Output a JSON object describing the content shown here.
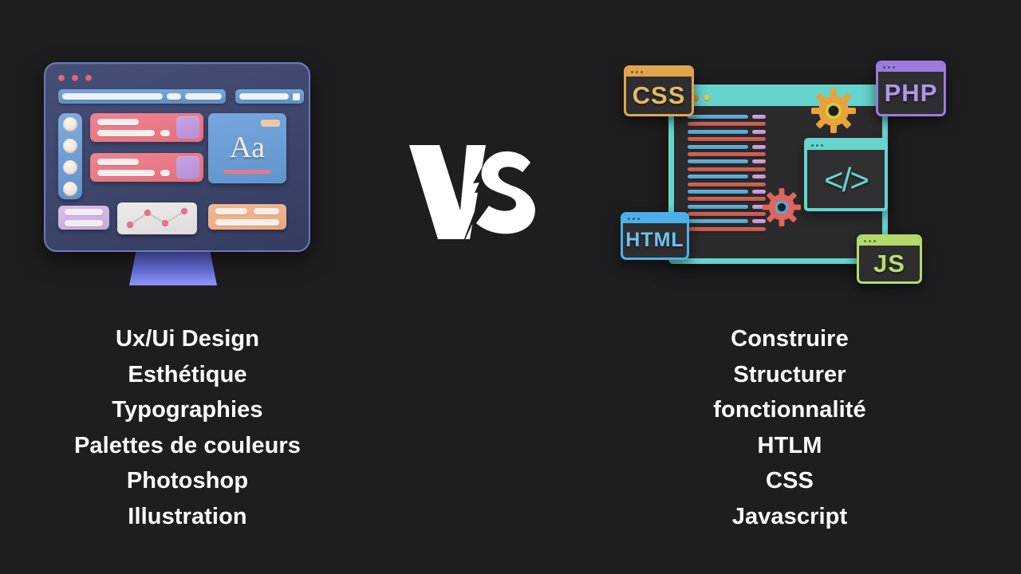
{
  "background_color": "#1e1e20",
  "center": {
    "logo_text": "VS",
    "logo_name": "versus-lightning-logo",
    "logo_color": "#ffffff"
  },
  "left": {
    "illustration_name": "ux-ui-design-monitor-illustration",
    "monitor": {
      "frame_color": "#3d456b",
      "border_color": "#6d79b8",
      "stand_color": "#6b74e2",
      "window_dots": [
        "#e06a7e",
        "#e06a7e",
        "#e06a7e"
      ],
      "typography_card": {
        "sample_text": "Aa",
        "background_color": "#6294cc",
        "underline_color": "#e4798f"
      },
      "rail_icon_count": 4,
      "pink_card_count": 2,
      "chart_point_count": 4
    },
    "items": [
      "Ux/Ui Design",
      "Esthétique",
      "Typographies",
      "Palettes de couleurs",
      "Photoshop",
      "Illustration"
    ]
  },
  "right": {
    "illustration_name": "web-development-code-illustration",
    "window": {
      "accent_color": "#66d4cd",
      "body_color": "#2b2b2d",
      "title_dots": [
        "#d4554c",
        "#e2943a",
        "#d8cc50"
      ],
      "code_line_colors": {
        "blue": "#4f9dc6",
        "red": "#bf5348",
        "tag": "#c28ccb"
      },
      "code_line_count": 16,
      "snippet_glyph": "</>",
      "snippet_color": "#66d4cd"
    },
    "gears": [
      {
        "name": "gear-orange",
        "color": "#e8a43a"
      },
      {
        "name": "gear-red",
        "color": "#e0655c"
      }
    ],
    "badges": [
      {
        "label": "CSS",
        "color": "#e0a64b"
      },
      {
        "label": "PHP",
        "color": "#9b7bdd"
      },
      {
        "label": "HTML",
        "color": "#4db0e8"
      },
      {
        "label": "JS",
        "color": "#b4d96a"
      }
    ],
    "items": [
      "Construire",
      "Structurer",
      "fonctionnalité",
      "HTLM",
      "CSS",
      "Javascript"
    ]
  }
}
